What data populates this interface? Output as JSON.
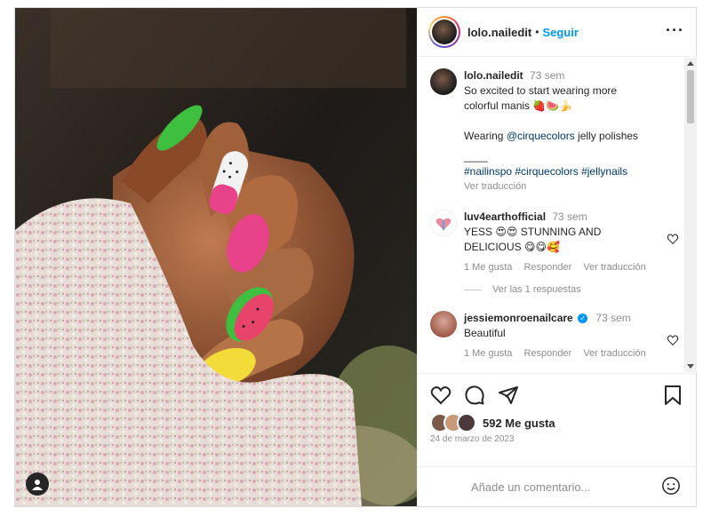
{
  "header": {
    "username": "lolo.nailedit",
    "separator": "•",
    "follow_label": "Seguir",
    "more_icon": "more-horizontal-icon"
  },
  "caption": {
    "username": "lolo.nailedit",
    "time": "73 sem",
    "line1": "So excited to start wearing more",
    "line2": "colorful manis 🍓🍉🍌",
    "line3_prefix": "Wearing ",
    "mention": "@cirquecolors",
    "line3_suffix": " jelly polishes",
    "divider": "____",
    "hashtags": "#nailinspo #cirquecolors #jellynails",
    "translate": "Ver traducción"
  },
  "comments": [
    {
      "username": "luv4earthofficial",
      "time": "73 sem",
      "text_line1": "YESS 😍😍 STUNNING AND",
      "text_line2": "DELICIOUS 😋😋🥰",
      "likes": "1 Me gusta",
      "reply": "Responder",
      "translate": "Ver traducción",
      "view_replies": "Ver las 1 respuestas"
    },
    {
      "username": "jessiemonroenailcare",
      "verified": "✓",
      "time": "73 sem",
      "text": "Beautiful",
      "likes": "1 Me gusta",
      "reply": "Responder",
      "translate": "Ver traducción"
    }
  ],
  "actions": {
    "like_icon": "heart-icon",
    "comment_icon": "comment-icon",
    "share_icon": "send-icon",
    "save_icon": "bookmark-icon",
    "likes_text": "592 Me gusta",
    "date": "24 de marzo de 2023"
  },
  "add_comment": {
    "placeholder": "Añade un comentario...",
    "emoji_icon": "emoji-icon"
  },
  "colors": {
    "accent": "#0095f6",
    "hashtag": "#00376b",
    "muted": "#8e8e8e",
    "nail_green": "#3fbf3f",
    "nail_pink": "#e8438a",
    "nail_yellow": "#f3dc3a"
  }
}
